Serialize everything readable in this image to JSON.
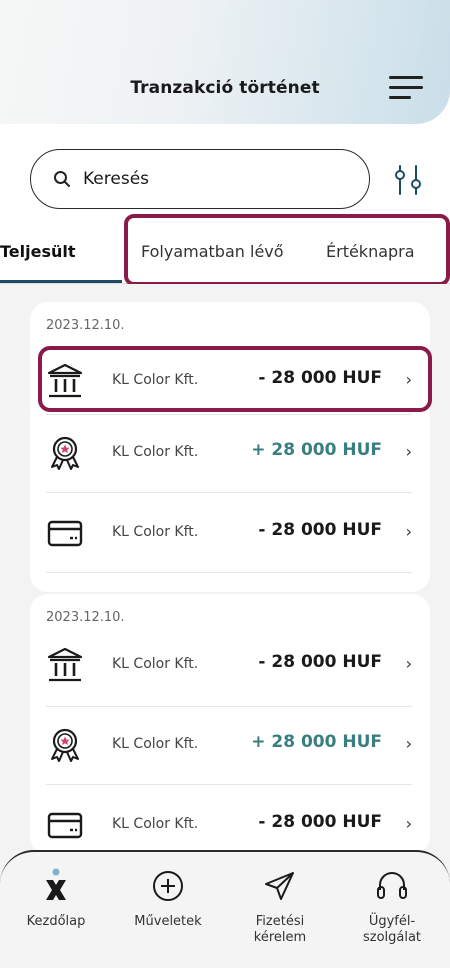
{
  "header": {
    "title": "Tranzakció történet"
  },
  "search": {
    "placeholder": "Keresés"
  },
  "tabs": [
    {
      "label": "Teljesült",
      "active": true
    },
    {
      "label": "Folyamatban lévő",
      "active": false
    },
    {
      "label": "Értéknapra",
      "active": false
    }
  ],
  "groups": [
    {
      "date": "2023.12.10.",
      "rows": [
        {
          "icon": "bank-icon",
          "merchant": "KL Color Kft.",
          "amount": "- 28 000 HUF"
        },
        {
          "icon": "reward-badge-icon",
          "merchant": "KL Color Kft.",
          "amount": "+ 28 000 HUF"
        },
        {
          "icon": "card-icon",
          "merchant": "KL Color Kft.",
          "amount": "- 28 000 HUF"
        }
      ]
    },
    {
      "date": "2023.12.10.",
      "rows": [
        {
          "icon": "bank-icon",
          "merchant": "KL Color Kft.",
          "amount": "- 28 000 HUF"
        },
        {
          "icon": "reward-badge-icon",
          "merchant": "KL Color Kft.",
          "amount": "+ 28 000 HUF"
        },
        {
          "icon": "card-icon",
          "merchant": "KL Color Kft.",
          "amount": "- 28 000 HUF"
        }
      ]
    }
  ],
  "nav": [
    {
      "label": "Kezdőlap",
      "icon": "home-logo-icon"
    },
    {
      "label": "Műveletek",
      "icon": "plus-circle-icon"
    },
    {
      "label": "Fizetési\nkérelem",
      "icon": "send-icon"
    },
    {
      "label": "Ügyfél-\nszolgálat",
      "icon": "headset-icon"
    }
  ],
  "colors": {
    "accent": "#1d4b66",
    "positive": "#3a7f80",
    "highlight": "#8a1a4a"
  }
}
